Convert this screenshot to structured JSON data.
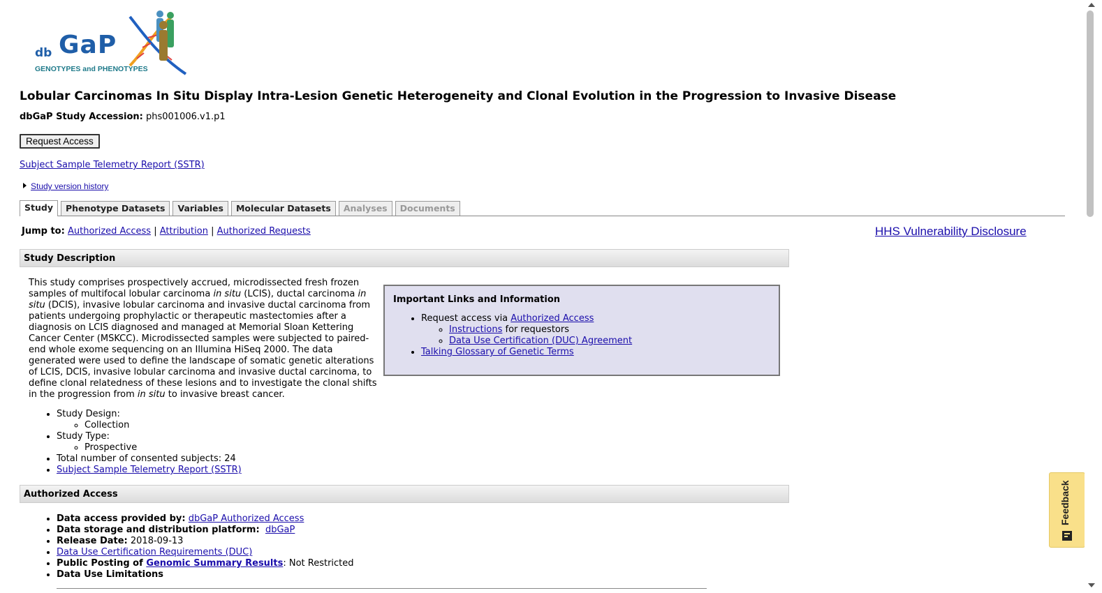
{
  "logo": {
    "small": "db",
    "big": "GaP",
    "tagline": "GENOTYPES and PHENOTYPES"
  },
  "title": "Lobular Carcinomas In Situ Display Intra-Lesion Genetic Heterogeneity and Clonal Evolution in the Progression to Invasive Disease",
  "accession": {
    "label": "dbGaP Study Accession:",
    "value": "phs001006.v1.p1"
  },
  "request_access_label": "Request Access",
  "sstr_link": "Subject Sample Telemetry Report (SSTR)",
  "study_history_link": "Study version history",
  "tabs": [
    {
      "label": "Study"
    },
    {
      "label": "Phenotype Datasets"
    },
    {
      "label": "Variables"
    },
    {
      "label": "Molecular Datasets"
    },
    {
      "label": "Analyses"
    },
    {
      "label": "Documents"
    }
  ],
  "jump": {
    "label": "Jump to:",
    "links": [
      "Authorized Access",
      "Attribution",
      "Authorized Requests"
    ],
    "sep": "|"
  },
  "hhs_link": "HHS Vulnerability Disclosure",
  "sections": {
    "study_description": "Study Description",
    "authorized_access": "Authorized Access"
  },
  "description": {
    "p1": "This study comprises prospectively accrued, microdissected fresh frozen samples of multifocal lobular carcinoma ",
    "it1": "in situ",
    "p2": " (LCIS), ductal carcinoma ",
    "it2": "in situ",
    "p3": " (DCIS), invasive lobular carcinoma and invasive ductal carcinoma from patients undergoing prophylactic or therapeutic mastectomies after a diagnosis on LCIS diagnosed and managed at Memorial Sloan Kettering Cancer Center (MSKCC). Microdissected samples were subjected to paired-end whole exome sequencing on an Illumina HiSeq 2000. The data generated were used to define the landscape of somatic genetic alterations of LCIS, DCIS, invasive lobular carcinoma and invasive ductal carcinoma, to define clonal relatedness of these lesions and to investigate the clonal shifts in the progression from ",
    "it3": "in situ",
    "p4": " to invasive breast cancer."
  },
  "infobox": {
    "title": "Important Links and Information",
    "request_prefix": "Request access via ",
    "request_link": "Authorized Access",
    "instructions_link": "Instructions",
    "instructions_suffix": " for requestors",
    "duc_link": "Data Use Certification (DUC) Agreement",
    "glossary_link": "Talking Glossary of Genetic Terms"
  },
  "study_list": {
    "design_label": "Study Design:",
    "design_value": "Collection",
    "type_label": "Study Type:",
    "type_value": "Prospective",
    "total_label": "Total number of consented subjects: 24",
    "sstr_link": "Subject Sample Telemetry Report (SSTR)"
  },
  "access_list": {
    "provided_label": "Data access provided by:",
    "provided_link": "dbGaP Authorized Access",
    "storage_label": "Data storage and distribution platform:",
    "storage_link": "dbGaP",
    "release_label": "Release Date:",
    "release_value": "2018-09-13",
    "duc_link": "Data Use Certification Requirements (DUC)",
    "posting_label": "Public Posting of ",
    "posting_link": "Genomic Summary Results",
    "posting_value": ": Not Restricted",
    "limitations_label": "Data Use Limitations"
  },
  "feedback_label": "Feedback",
  "colors": {
    "link": "#1a0dab",
    "infobox_bg": "#e0dfef",
    "feedback_bg": "#f9e08a"
  }
}
